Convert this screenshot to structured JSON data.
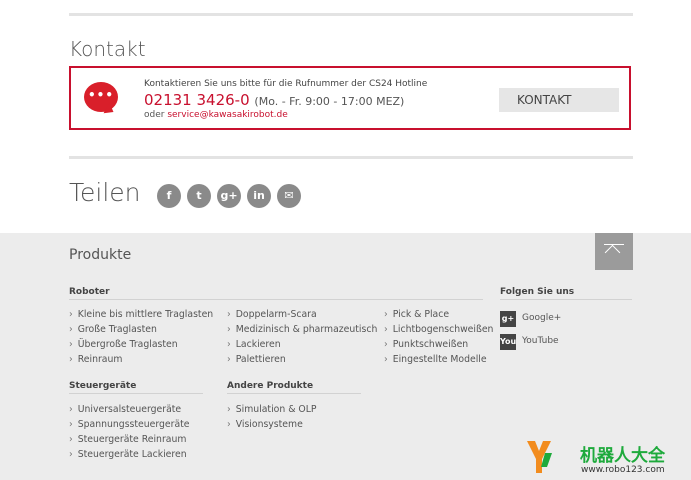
{
  "contact": {
    "heading": "Kontakt",
    "line1": "Kontaktieren Sie uns bitte für die Rufnummer der CS24 Hotline",
    "phone": "02131 3426-0",
    "hours": "(Mo. - Fr. 9:00 - 17:00 MEZ)",
    "or_text": "oder ",
    "email": "service@kawasakirobot.de",
    "button_label": "KONTAKT",
    "bubble_dots": "•••"
  },
  "share": {
    "heading": "Teilen",
    "icons": [
      {
        "name": "facebook-icon",
        "glyph": "f"
      },
      {
        "name": "twitter-icon",
        "glyph": "t"
      },
      {
        "name": "google-plus-icon",
        "glyph": "g+"
      },
      {
        "name": "linkedin-icon",
        "glyph": "in"
      },
      {
        "name": "email-icon",
        "glyph": "✉"
      }
    ]
  },
  "footer": {
    "title": "Produkte",
    "roboter_heading": "Roboter",
    "roboter_col1": [
      "Kleine bis mittlere Traglasten",
      "Große Traglasten",
      "Übergroße Traglasten",
      "Reinraum"
    ],
    "roboter_col2": [
      "Doppelarm-Scara",
      "Medizinisch & pharmazeutisch",
      "Lackieren",
      "Palettieren"
    ],
    "roboter_col3": [
      "Pick & Place",
      "Lichtbogenschweißen",
      "Punktschweißen",
      "Eingestellte Modelle"
    ],
    "steuer_heading": "Steuergeräte",
    "steuer_items": [
      "Universalsteuergeräte",
      "Spannungssteuergeräte",
      "Steuergeräte Reinraum",
      "Steuergeräte Lackieren"
    ],
    "andere_heading": "Andere Produkte",
    "andere_items": [
      "Simulation & OLP",
      "Visionsysteme"
    ],
    "follow_heading": "Folgen Sie uns",
    "follow_items": [
      {
        "label": "Google+",
        "icon": "google-plus-icon",
        "glyph": "g+"
      },
      {
        "label": "YouTube",
        "icon": "youtube-icon",
        "glyph": "You"
      }
    ]
  },
  "watermark": {
    "name": "机器人大全",
    "url": "www.robo123.com"
  },
  "colors": {
    "accent": "#c8102e",
    "footer_bg": "#ececec"
  }
}
